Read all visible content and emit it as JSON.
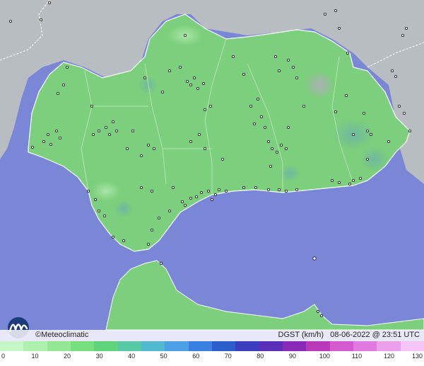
{
  "attribution": "©Meteoclimatic",
  "caption": {
    "variable": "DGST (km/h)",
    "timestamp": "08-06-2022 @ 23:51 UTC"
  },
  "legend": {
    "ticks": [
      "0",
      "10",
      "20",
      "30",
      "40",
      "50",
      "60",
      "70",
      "80",
      "90",
      "100",
      "110",
      "120",
      "130"
    ],
    "colors": [
      "#c6f7c6",
      "#aef0ae",
      "#94e894",
      "#78df80",
      "#5fd47a",
      "#58c9a4",
      "#52b9d1",
      "#4ea0e6",
      "#3b7fe0",
      "#2b5fcc",
      "#3b3fbf",
      "#5a2fb8",
      "#8a2ab8",
      "#b83ab8",
      "#d45ad0",
      "#e07ae0",
      "#eca0ec",
      "#f5c6f5"
    ]
  },
  "map": {
    "sea_color": "#7a86d6",
    "land_color": "#7ccf7c",
    "outside_land_color": "#b8bdc2",
    "station_icon": "station-dot-icon"
  }
}
